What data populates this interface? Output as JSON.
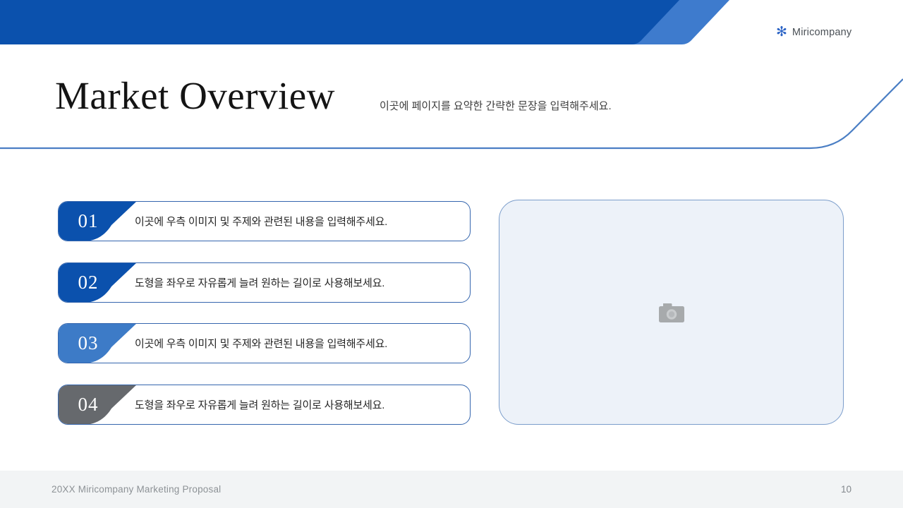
{
  "slide": {
    "header": {
      "logo": {
        "icon": "snowflake-asterisk-icon",
        "label": "Miricompany"
      }
    },
    "title": "Market Overview",
    "subtitle": "이곳에 페이지를 요약한 간략한 문장을 입력해주세요.",
    "list": {
      "items": [
        {
          "number": "01",
          "text": "이곳에 우측 이미지 및 주제와 관련된 내용을 입력해주세요.",
          "badge_color": "#0b51ad"
        },
        {
          "number": "02",
          "text": "도형을 좌우로 자유롭게 늘려 원하는 길이로 사용해보세요.",
          "badge_color": "#0b51ad"
        },
        {
          "number": "03",
          "text": "이곳에 우측 이미지 및 주제와 관련된 내용을 입력해주세요.",
          "badge_color": "#3d7bc7"
        },
        {
          "number": "04",
          "text": "도형을 좌우로 자유롭게 늘려 원하는 길이로 사용해보세요.",
          "badge_color": "#66696d"
        }
      ]
    },
    "image_placeholder": {
      "icon": "camera-icon",
      "body_color": "#a7aaac",
      "lens_color": "#c9ccce",
      "lens_inner_color": "#b6b9bc"
    },
    "footer": {
      "left_text": "20XX Miricompany Marketing Proposal",
      "page_number": "10"
    },
    "colors": {
      "header_dark": "#0b51ad",
      "header_light": "#3e7bcd",
      "divider_line": "#4a7ec4",
      "item_border": "#3566ae",
      "logo_blue": "#2b63c5"
    }
  }
}
